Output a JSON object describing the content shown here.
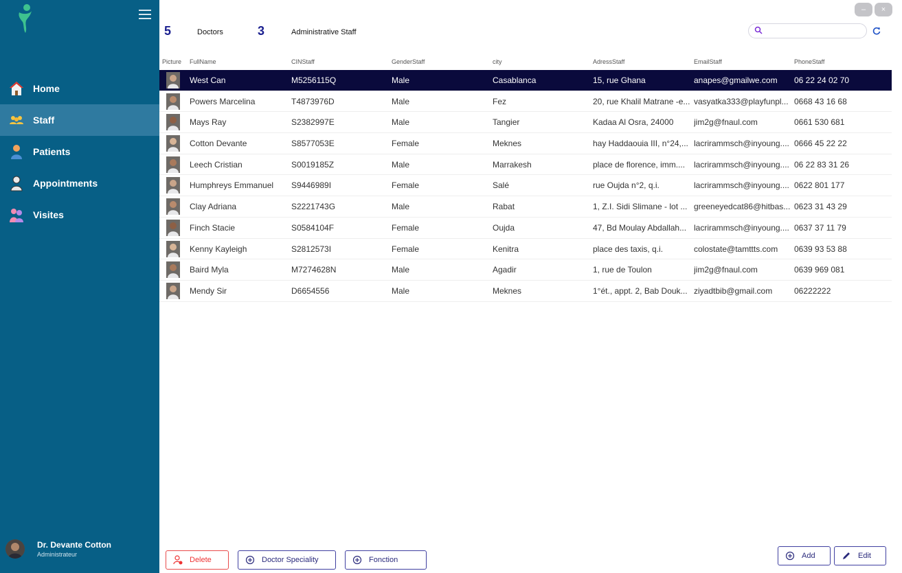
{
  "counts": {
    "doctors_count": "5",
    "doctors_label": "Doctors",
    "admin_count": "3",
    "admin_label": "Administrative Staff"
  },
  "search": {
    "placeholder": ""
  },
  "window": {
    "minimize": "–",
    "close": "×"
  },
  "sidebar": {
    "items": [
      {
        "label": "Home",
        "icon": "home-icon"
      },
      {
        "label": "Staff",
        "icon": "staff-icon"
      },
      {
        "label": "Patients",
        "icon": "patient-icon"
      },
      {
        "label": "Appointments",
        "icon": "appointment-icon"
      },
      {
        "label": "Visites",
        "icon": "visits-icon"
      }
    ],
    "user": {
      "name": "Dr. Devante Cotton",
      "role": "Administrateur"
    }
  },
  "table": {
    "columns": [
      "Picture",
      "FullName",
      "CINStaff",
      "GenderStaff",
      "city",
      "AdressStaff",
      "EmailStaff",
      "PhoneStaff"
    ],
    "rows": [
      {
        "name": "West Can",
        "cin": "M5256115Q",
        "gender": "Male",
        "city": "Casablanca",
        "address": "15, rue Ghana",
        "email": "anapes@gmailwe.com",
        "phone": "06 22 24 02 70"
      },
      {
        "name": "Powers Marcelina",
        "cin": "T4873976D",
        "gender": "Male",
        "city": "Fez",
        "address": "20, rue Khalil Matrane -e...",
        "email": "vasyatka333@playfunpl...",
        "phone": "0668 43 16 68"
      },
      {
        "name": "Mays Ray",
        "cin": "S2382997E",
        "gender": "Male",
        "city": "Tangier",
        "address": "Kadaa Al Osra, 24000",
        "email": "jim2g@fnaul.com",
        "phone": "0661 530 681"
      },
      {
        "name": "Cotton Devante",
        "cin": "S8577053E",
        "gender": "Female",
        "city": "Meknes",
        "address": "hay Haddaouia III, n°24,...",
        "email": "lacrirammsch@inyoung....",
        "phone": "0666 45 22 22"
      },
      {
        "name": "Leech Cristian",
        "cin": "S0019185Z",
        "gender": "Male",
        "city": "Marrakesh",
        "address": " place de florence, imm....",
        "email": "lacrirammsch@inyoung....",
        "phone": "06 22 83 31 26"
      },
      {
        "name": "Humphreys Emmanuel",
        "cin": "S9446989I",
        "gender": "Female",
        "city": "Salé",
        "address": "rue Oujda n°2, q.i.",
        "email": "lacrirammsch@inyoung....",
        "phone": "0622 801 177"
      },
      {
        "name": "Clay Adriana",
        "cin": "S2221743G",
        "gender": "Male",
        "city": "Rabat",
        "address": " 1, Z.I. Sidi Slimane - lot ...",
        "email": "greeneyedcat86@hitbas...",
        "phone": "0623 31 43 29"
      },
      {
        "name": "Finch Stacie",
        "cin": "S0584104F",
        "gender": "Female",
        "city": "Oujda",
        "address": "47, Bd Moulay Abdallah...",
        "email": "lacrirammsch@inyoung....",
        "phone": "0637 37 11 79"
      },
      {
        "name": "Kenny Kayleigh",
        "cin": "S2812573I",
        "gender": "Female",
        "city": "Kenitra",
        "address": "place des taxis, q.i.",
        "email": "colostate@tamttts.com",
        "phone": "0639 93 53 88"
      },
      {
        "name": "Baird Myla",
        "cin": "M7274628N",
        "gender": "Male",
        "city": "Agadir",
        "address": "1, rue de Toulon",
        "email": "jim2g@fnaul.com",
        "phone": "0639 969 081"
      },
      {
        "name": "Mendy Sir",
        "cin": "D6654556",
        "gender": "Male",
        "city": "Meknes",
        "address": "1°ét., appt. 2, Bab Douk...",
        "email": "ziyadtbib@gmail.com",
        "phone": "06222222"
      }
    ]
  },
  "buttons": {
    "delete": "Delete",
    "doctor_speciality": "Doctor Speciality",
    "fonction": "Fonction",
    "add": "Add",
    "edit": "Edit"
  },
  "colors": {
    "sidebar": "#075f86",
    "selected_row": "#0a0a3c",
    "accent": "#1a1f8f",
    "danger": "#e33333"
  }
}
